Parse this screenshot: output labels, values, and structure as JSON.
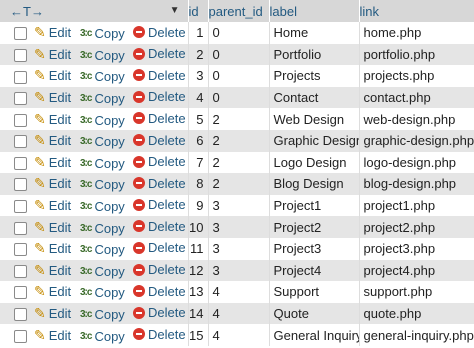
{
  "header": {
    "arrows_label": "←T→",
    "sort_indicator": "▼",
    "columns": [
      "id",
      "parent_id",
      "label",
      "link"
    ]
  },
  "actions": {
    "edit": "Edit",
    "copy": "Copy",
    "delete": "Delete"
  },
  "rows": [
    {
      "id": "1",
      "parent_id": "0",
      "label": "Home",
      "link": "home.php"
    },
    {
      "id": "2",
      "parent_id": "0",
      "label": "Portfolio",
      "link": "portfolio.php"
    },
    {
      "id": "3",
      "parent_id": "0",
      "label": "Projects",
      "link": "projects.php"
    },
    {
      "id": "4",
      "parent_id": "0",
      "label": "Contact",
      "link": "contact.php"
    },
    {
      "id": "5",
      "parent_id": "2",
      "label": "Web Design",
      "link": "web-design.php"
    },
    {
      "id": "6",
      "parent_id": "2",
      "label": "Graphic Design",
      "link": "graphic-design.php"
    },
    {
      "id": "7",
      "parent_id": "2",
      "label": "Logo Design",
      "link": "logo-design.php"
    },
    {
      "id": "8",
      "parent_id": "2",
      "label": "Blog Design",
      "link": "blog-design.php"
    },
    {
      "id": "9",
      "parent_id": "3",
      "label": "Project1",
      "link": "project1.php"
    },
    {
      "id": "10",
      "parent_id": "3",
      "label": "Project2",
      "link": "project2.php"
    },
    {
      "id": "11",
      "parent_id": "3",
      "label": "Project3",
      "link": "project3.php"
    },
    {
      "id": "12",
      "parent_id": "3",
      "label": "Project4",
      "link": "project4.php"
    },
    {
      "id": "13",
      "parent_id": "4",
      "label": "Support",
      "link": "support.php"
    },
    {
      "id": "14",
      "parent_id": "4",
      "label": "Quote",
      "link": "quote.php"
    },
    {
      "id": "15",
      "parent_id": "4",
      "label": "General Inquiry",
      "link": "general-inquiry.php"
    }
  ],
  "colors": {
    "link": "#235a81",
    "header_bg": "#d7d7d7",
    "stripe": "#e5e5e5",
    "delete": "#d9362b"
  }
}
